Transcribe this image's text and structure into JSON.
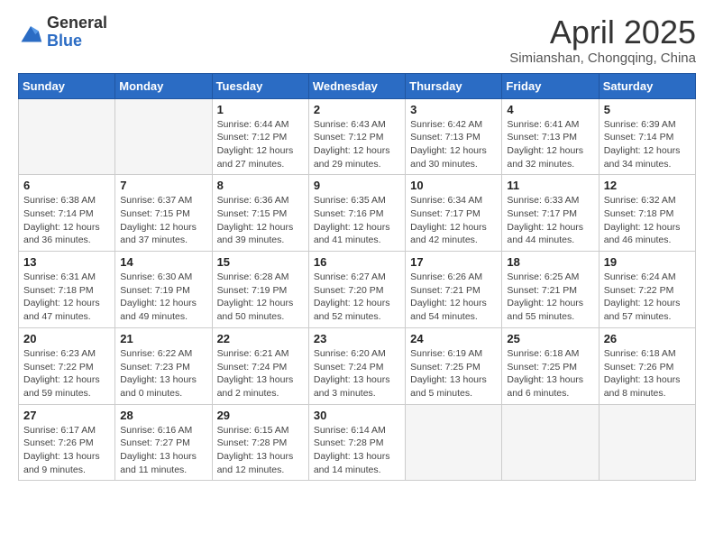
{
  "logo": {
    "general": "General",
    "blue": "Blue"
  },
  "title": "April 2025",
  "subtitle": "Simianshan, Chongqing, China",
  "days_of_week": [
    "Sunday",
    "Monday",
    "Tuesday",
    "Wednesday",
    "Thursday",
    "Friday",
    "Saturday"
  ],
  "weeks": [
    [
      {
        "day": "",
        "info": ""
      },
      {
        "day": "",
        "info": ""
      },
      {
        "day": "1",
        "info": "Sunrise: 6:44 AM\nSunset: 7:12 PM\nDaylight: 12 hours and 27 minutes."
      },
      {
        "day": "2",
        "info": "Sunrise: 6:43 AM\nSunset: 7:12 PM\nDaylight: 12 hours and 29 minutes."
      },
      {
        "day": "3",
        "info": "Sunrise: 6:42 AM\nSunset: 7:13 PM\nDaylight: 12 hours and 30 minutes."
      },
      {
        "day": "4",
        "info": "Sunrise: 6:41 AM\nSunset: 7:13 PM\nDaylight: 12 hours and 32 minutes."
      },
      {
        "day": "5",
        "info": "Sunrise: 6:39 AM\nSunset: 7:14 PM\nDaylight: 12 hours and 34 minutes."
      }
    ],
    [
      {
        "day": "6",
        "info": "Sunrise: 6:38 AM\nSunset: 7:14 PM\nDaylight: 12 hours and 36 minutes."
      },
      {
        "day": "7",
        "info": "Sunrise: 6:37 AM\nSunset: 7:15 PM\nDaylight: 12 hours and 37 minutes."
      },
      {
        "day": "8",
        "info": "Sunrise: 6:36 AM\nSunset: 7:15 PM\nDaylight: 12 hours and 39 minutes."
      },
      {
        "day": "9",
        "info": "Sunrise: 6:35 AM\nSunset: 7:16 PM\nDaylight: 12 hours and 41 minutes."
      },
      {
        "day": "10",
        "info": "Sunrise: 6:34 AM\nSunset: 7:17 PM\nDaylight: 12 hours and 42 minutes."
      },
      {
        "day": "11",
        "info": "Sunrise: 6:33 AM\nSunset: 7:17 PM\nDaylight: 12 hours and 44 minutes."
      },
      {
        "day": "12",
        "info": "Sunrise: 6:32 AM\nSunset: 7:18 PM\nDaylight: 12 hours and 46 minutes."
      }
    ],
    [
      {
        "day": "13",
        "info": "Sunrise: 6:31 AM\nSunset: 7:18 PM\nDaylight: 12 hours and 47 minutes."
      },
      {
        "day": "14",
        "info": "Sunrise: 6:30 AM\nSunset: 7:19 PM\nDaylight: 12 hours and 49 minutes."
      },
      {
        "day": "15",
        "info": "Sunrise: 6:28 AM\nSunset: 7:19 PM\nDaylight: 12 hours and 50 minutes."
      },
      {
        "day": "16",
        "info": "Sunrise: 6:27 AM\nSunset: 7:20 PM\nDaylight: 12 hours and 52 minutes."
      },
      {
        "day": "17",
        "info": "Sunrise: 6:26 AM\nSunset: 7:21 PM\nDaylight: 12 hours and 54 minutes."
      },
      {
        "day": "18",
        "info": "Sunrise: 6:25 AM\nSunset: 7:21 PM\nDaylight: 12 hours and 55 minutes."
      },
      {
        "day": "19",
        "info": "Sunrise: 6:24 AM\nSunset: 7:22 PM\nDaylight: 12 hours and 57 minutes."
      }
    ],
    [
      {
        "day": "20",
        "info": "Sunrise: 6:23 AM\nSunset: 7:22 PM\nDaylight: 12 hours and 59 minutes."
      },
      {
        "day": "21",
        "info": "Sunrise: 6:22 AM\nSunset: 7:23 PM\nDaylight: 13 hours and 0 minutes."
      },
      {
        "day": "22",
        "info": "Sunrise: 6:21 AM\nSunset: 7:24 PM\nDaylight: 13 hours and 2 minutes."
      },
      {
        "day": "23",
        "info": "Sunrise: 6:20 AM\nSunset: 7:24 PM\nDaylight: 13 hours and 3 minutes."
      },
      {
        "day": "24",
        "info": "Sunrise: 6:19 AM\nSunset: 7:25 PM\nDaylight: 13 hours and 5 minutes."
      },
      {
        "day": "25",
        "info": "Sunrise: 6:18 AM\nSunset: 7:25 PM\nDaylight: 13 hours and 6 minutes."
      },
      {
        "day": "26",
        "info": "Sunrise: 6:18 AM\nSunset: 7:26 PM\nDaylight: 13 hours and 8 minutes."
      }
    ],
    [
      {
        "day": "27",
        "info": "Sunrise: 6:17 AM\nSunset: 7:26 PM\nDaylight: 13 hours and 9 minutes."
      },
      {
        "day": "28",
        "info": "Sunrise: 6:16 AM\nSunset: 7:27 PM\nDaylight: 13 hours and 11 minutes."
      },
      {
        "day": "29",
        "info": "Sunrise: 6:15 AM\nSunset: 7:28 PM\nDaylight: 13 hours and 12 minutes."
      },
      {
        "day": "30",
        "info": "Sunrise: 6:14 AM\nSunset: 7:28 PM\nDaylight: 13 hours and 14 minutes."
      },
      {
        "day": "",
        "info": ""
      },
      {
        "day": "",
        "info": ""
      },
      {
        "day": "",
        "info": ""
      }
    ]
  ]
}
